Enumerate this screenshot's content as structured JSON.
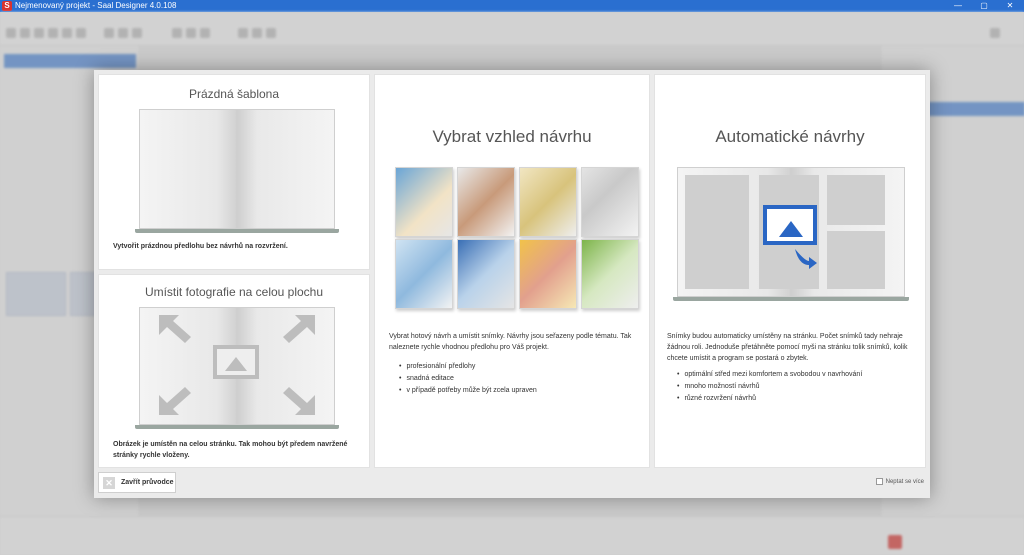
{
  "window": {
    "title": "Nejmenovaný projekt - Saal Designer 4.0.108",
    "app_icon": "S",
    "minimize": "—",
    "maximize": "▢",
    "close": "✕"
  },
  "wizard": {
    "cards": {
      "empty": {
        "title": "Prázdná šablona",
        "description": "Vytvořit prázdnou předlohu bez návrhů na rozvržení."
      },
      "fullpage": {
        "title": "Umístit fotografie na celou plochu",
        "description": "Obrázek je umístěn na celou stránku. Tak mohou být předem navržené stránky rychle vloženy."
      },
      "design": {
        "title": "Vybrat vzhled návrhu",
        "description": "Vybrat hotový návrh a umístit snímky. Návrhy jsou seřazeny podle tématu. Tak naleznete rychle vhodnou předlohu pro Váš projekt.",
        "bullets": [
          "profesionální předlohy",
          "snadná editace",
          "v případě potřeby může být zcela upraven"
        ]
      },
      "auto": {
        "title": "Automatické návrhy",
        "description": "Snímky budou automaticky umístěny na stránku. Počet snímků tady nehraje žádnou roli. Jednoduše přetáhněte pomocí myši na stránku tolik snímků, kolik chcete umístit a program se postará o zbytek.",
        "bullets": [
          "optimální střed mezi komfortem a svobodou v navrhování",
          "mnoho možností návrhů",
          "různé rozvržení návrhů"
        ]
      }
    },
    "close_label": "Zavřít průvodce",
    "dont_ask_label": "Neptat se více"
  },
  "colors": {
    "titlebar": "#2a6fd0",
    "accent_blue": "#2a66c4",
    "brand_red": "#d9332f"
  }
}
